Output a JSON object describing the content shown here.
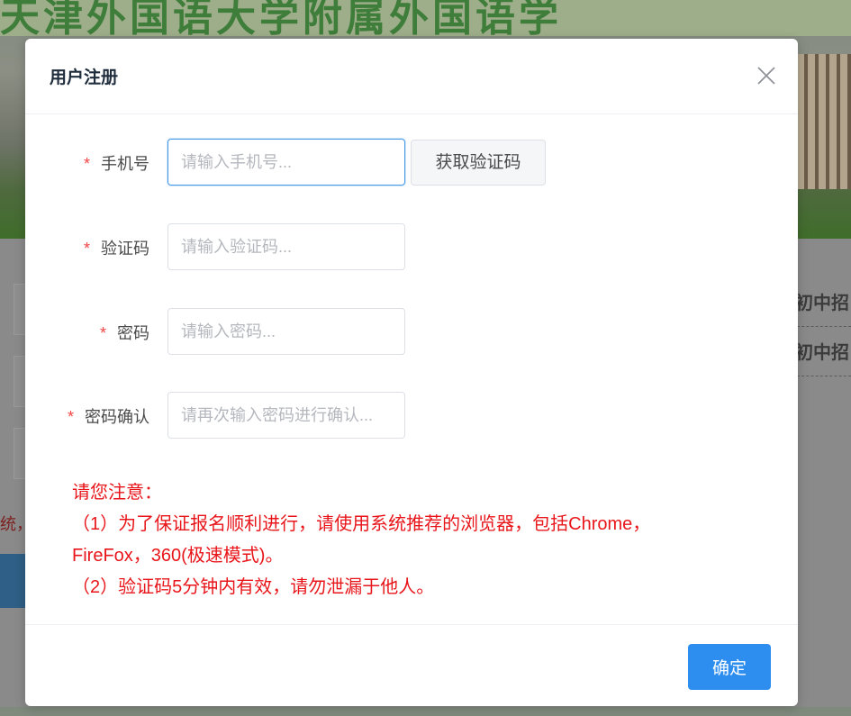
{
  "background": {
    "banner_title": "天津外国语大学附属外国语学",
    "links": [
      "初中招",
      "初中招"
    ],
    "left_text": "统，"
  },
  "modal": {
    "title": "用户注册",
    "close_icon": "close-icon",
    "fields": [
      {
        "label": "手机号",
        "placeholder": "请输入手机号...",
        "value": "",
        "required": "*"
      },
      {
        "label": "验证码",
        "placeholder": "请输入验证码...",
        "value": "",
        "required": "*"
      },
      {
        "label": "密码",
        "placeholder": "请输入密码...",
        "value": "",
        "required": "*"
      },
      {
        "label": "密码确认",
        "placeholder": "请再次输入密码进行确认...",
        "value": "",
        "required": "*"
      }
    ],
    "get_code_label": "获取验证码",
    "notice": {
      "title": "请您注意：",
      "line1": "（1）为了保证报名顺利进行，请使用系统推荐的浏览器，包括Chrome，",
      "line2": "FireFox，360(极速模式)。",
      "line3": "（2）验证码5分钟内有效，请勿泄漏于他人。"
    },
    "confirm_label": "确定"
  },
  "colors": {
    "primary": "#2d8ef0",
    "notice_red": "#e8161b",
    "required_red": "#f04545",
    "focus_border": "#4a9ae8"
  }
}
